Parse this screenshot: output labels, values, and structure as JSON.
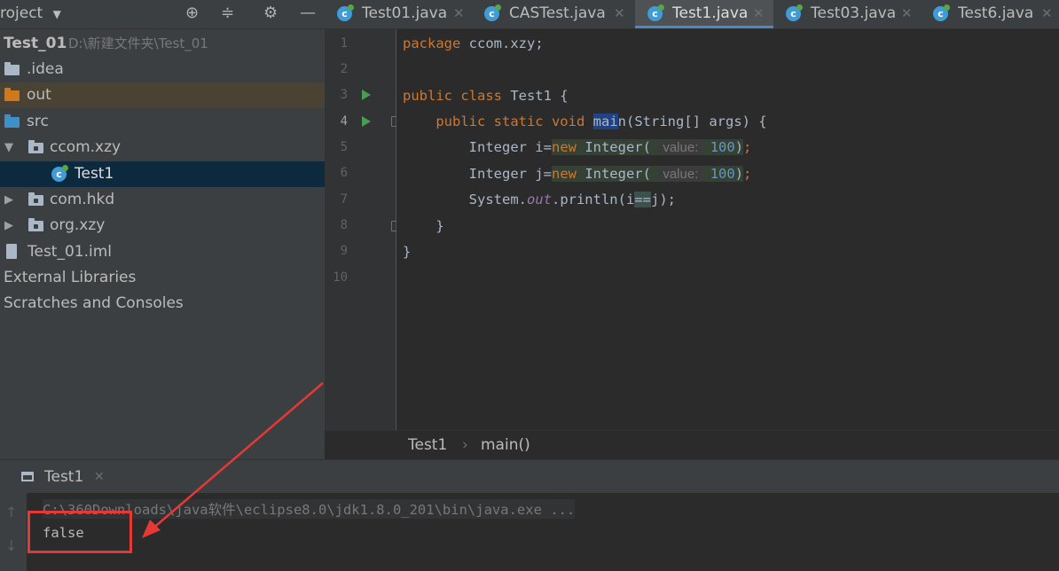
{
  "project_panel": {
    "title": "roject",
    "root_name": "Test_01",
    "root_path": "D:\\新建文件夹\\Test_01",
    "items": [
      {
        "label": ".idea"
      },
      {
        "label": "out"
      },
      {
        "label": "src"
      },
      {
        "label": "ccom.xzy"
      },
      {
        "label": "Test1"
      },
      {
        "label": "com.hkd"
      },
      {
        "label": "org.xzy"
      },
      {
        "label": "Test_01.iml"
      },
      {
        "label": "External Libraries"
      },
      {
        "label": "Scratches and Consoles"
      }
    ],
    "icons": [
      "locate-icon",
      "collapse-icon",
      "gear-icon",
      "minimize-icon"
    ]
  },
  "tabs": [
    {
      "label": "Test01.java"
    },
    {
      "label": "CASTest.java"
    },
    {
      "label": "Test1.java",
      "active": true
    },
    {
      "label": "Test03.java"
    },
    {
      "label": "Test6.java"
    }
  ],
  "editor": {
    "line_numbers": [
      "1",
      "2",
      "3",
      "4",
      "5",
      "6",
      "7",
      "8",
      "9",
      "10"
    ],
    "code": {
      "l1_kw": "package",
      "l1_rest": " ccom.xzy;",
      "l3_kw": "public class",
      "l3_rest": " Test1 {",
      "l4_kw": "public static void",
      "l4_main_a": "mai",
      "l4_main_b": "n",
      "l4_rest": "(String[] args) {",
      "l5_a": "Integer i=",
      "l5_new": "new",
      "l5_b": " Integer(",
      "l5_hint": "value:",
      "l5_num": "100",
      "l5_end": ");",
      "l6_a": "Integer j=",
      "l6_new": "new",
      "l6_b": " Integer(",
      "l6_hint": "value:",
      "l6_num": "100",
      "l6_end": ");",
      "l7_a": "System.",
      "l7_out": "out",
      "l7_b": ".println(i",
      "l7_op": "==",
      "l7_c": "j);",
      "l8": "}",
      "l9": "}"
    }
  },
  "breadcrumbs": {
    "class_name": "Test1",
    "separator": "›",
    "method": "main()"
  },
  "run_panel": {
    "tab_label": "Test1",
    "command": "C:\\360Downloads\\java软件\\eclipse8.0\\jdk1.8.0_201\\bin\\java.exe ...",
    "output": "false"
  },
  "colors": {
    "keyword": "#cc7832",
    "number": "#6897bb",
    "annotation_red": "#e53935",
    "active_tab_underline": "#4a88c7"
  }
}
